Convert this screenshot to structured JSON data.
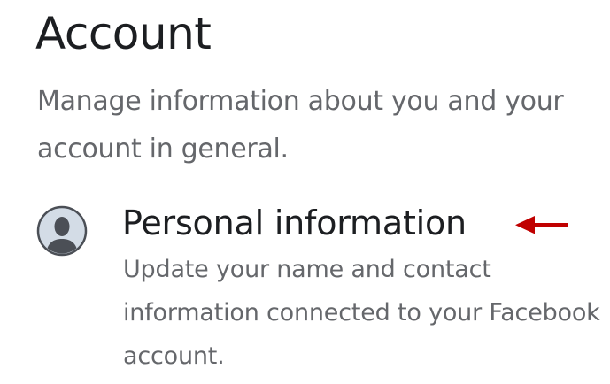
{
  "section": {
    "title": "Account",
    "description": "Manage information about you and your account in general."
  },
  "items": [
    {
      "title": "Personal information",
      "description": "Update your name and contact information connected to your Facebook account.",
      "icon": "user-avatar-icon"
    }
  ],
  "colors": {
    "title_text": "#1c1e21",
    "secondary_text": "#65676b",
    "annotation_arrow": "#c00000",
    "avatar_bg": "#d3dce6",
    "avatar_figure": "#4b4f56"
  }
}
